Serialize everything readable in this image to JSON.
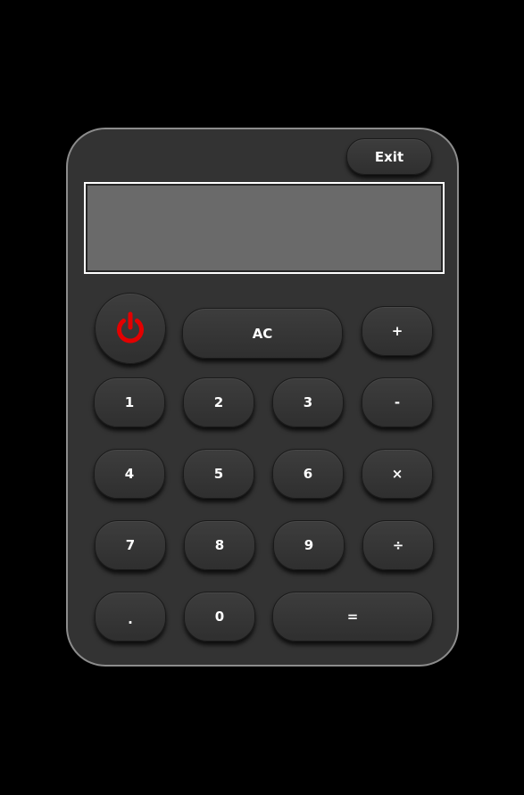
{
  "header": {
    "exit_label": "Exit"
  },
  "display": {
    "value": ""
  },
  "colors": {
    "background": "#000000",
    "body": "#333333",
    "body_border": "#8c8c8c",
    "screen": "#6a6a6a",
    "power_icon": "#e30000",
    "text": "#ffffff"
  },
  "keys": {
    "power_icon": "power-icon",
    "clear": "AC",
    "add": "+",
    "subtract": "-",
    "multiply": "×",
    "divide": "÷",
    "equals": "=",
    "decimal": ".",
    "digits": {
      "d0": "0",
      "d1": "1",
      "d2": "2",
      "d3": "3",
      "d4": "4",
      "d5": "5",
      "d6": "6",
      "d7": "7",
      "d8": "8",
      "d9": "9"
    }
  }
}
